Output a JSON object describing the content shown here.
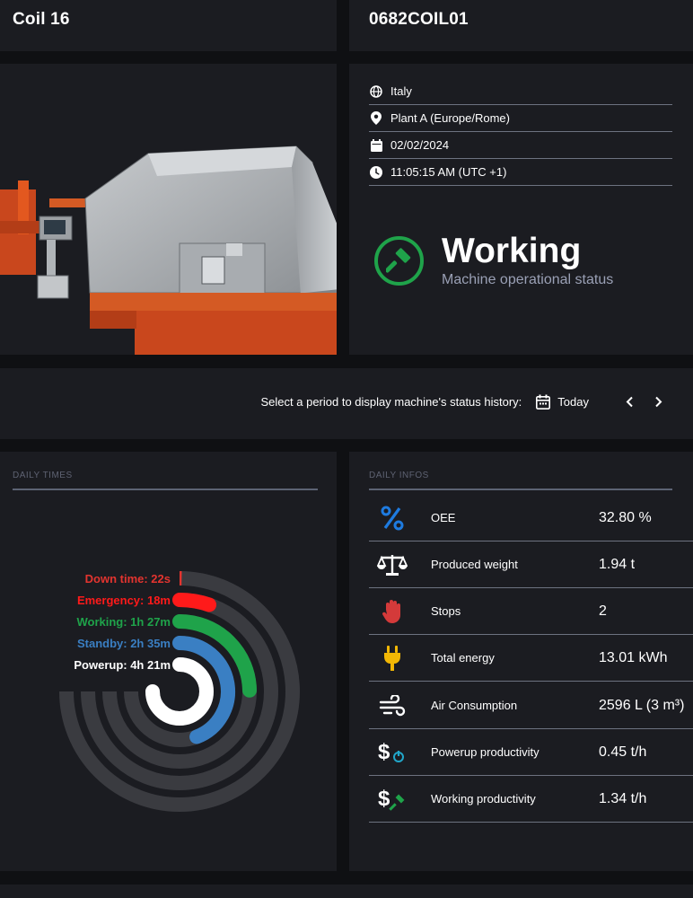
{
  "header": {
    "machine_name": "Coil 16",
    "machine_code": "0682COIL01"
  },
  "info": {
    "country": "Italy",
    "plant": "Plant A (Europe/Rome)",
    "date": "02/02/2024",
    "time": "11:05:15 AM (UTC +1)"
  },
  "status": {
    "title": "Working",
    "subtitle": "Machine operational status",
    "color": "#1fa34a",
    "icon": "hammer-icon"
  },
  "period": {
    "label": "Select a period to display machine's status history:",
    "value": "Today"
  },
  "daily_times": {
    "title": "DAILY TIMES",
    "items": [
      {
        "label": "Down time: 22s",
        "color": "#e3342f",
        "fraction": 0.004
      },
      {
        "label": "Emergency: 18m",
        "color": "#ff1a1a",
        "fraction": 0.07
      },
      {
        "label": "Working: 1h 27m",
        "color": "#1fa34a",
        "fraction": 0.33
      },
      {
        "label": "Standby: 2h 35m",
        "color": "#3a7fc3",
        "fraction": 0.59
      },
      {
        "label": "Powerup: 4h 21m",
        "color": "#ffffff",
        "fraction": 1.0
      }
    ]
  },
  "daily_infos": {
    "title": "DAILY INFOS",
    "rows": [
      {
        "icon": "percent-icon",
        "label": "OEE",
        "value": "32.80 %"
      },
      {
        "icon": "balance-scale-icon",
        "label": "Produced weight",
        "value": "1.94 t"
      },
      {
        "icon": "hand-stop-icon",
        "label": "Stops",
        "value": "2"
      },
      {
        "icon": "plug-icon",
        "label": "Total energy",
        "value": "13.01 kWh"
      },
      {
        "icon": "wind-icon",
        "label": "Air Consumption",
        "value": "2596 L (3 m³)"
      },
      {
        "icon": "dollar-power-icon",
        "label": "Powerup productivity",
        "value": "0.45 t/h"
      },
      {
        "icon": "dollar-hammer-icon",
        "label": "Working productivity",
        "value": "1.34 t/h"
      }
    ]
  }
}
